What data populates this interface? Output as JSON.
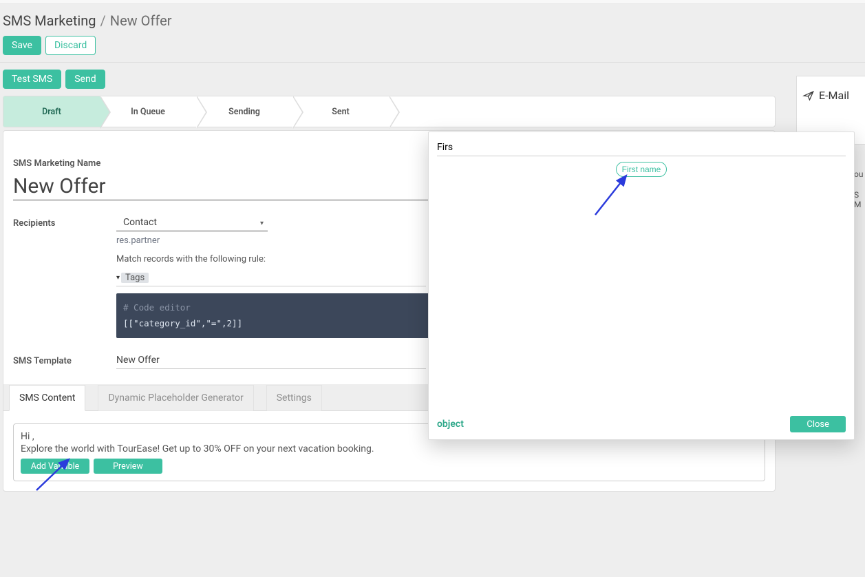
{
  "breadcrumb": {
    "root": "SMS Marketing",
    "current": "New Offer"
  },
  "toolbar": {
    "save": "Save",
    "discard": "Discard",
    "test_sms": "Test SMS",
    "send": "Send"
  },
  "status": [
    "Draft",
    "In Queue",
    "Sending",
    "Sent"
  ],
  "right": {
    "email": "E-Mail",
    "ghost1": "ou",
    "ghost2": "S M"
  },
  "form": {
    "name_label": "SMS Marketing Name",
    "name_value": "New Offer",
    "recipients_label": "Recipients",
    "recipients_select": "Contact",
    "recipients_model": "res.partner",
    "match_label": "Match records with the following rule:",
    "tags_label": "Tags",
    "code_comment": "# Code editor",
    "code_content": "[[\"category_id\",\"=\",2]]",
    "template_label": "SMS Template",
    "template_value": "New Offer"
  },
  "tabs": {
    "content": "SMS Content",
    "placeholder": "Dynamic Placeholder Generator",
    "settings": "Settings"
  },
  "sms": {
    "line1": "Hi ,",
    "line2": "Explore the world with TourEase! Get up to 30% OFF on your next vacation booking.",
    "add_variable": "Add Variable",
    "preview": "Preview"
  },
  "popup": {
    "search": "Firs",
    "suggestion": "First name",
    "object": "object",
    "close": "Close"
  }
}
